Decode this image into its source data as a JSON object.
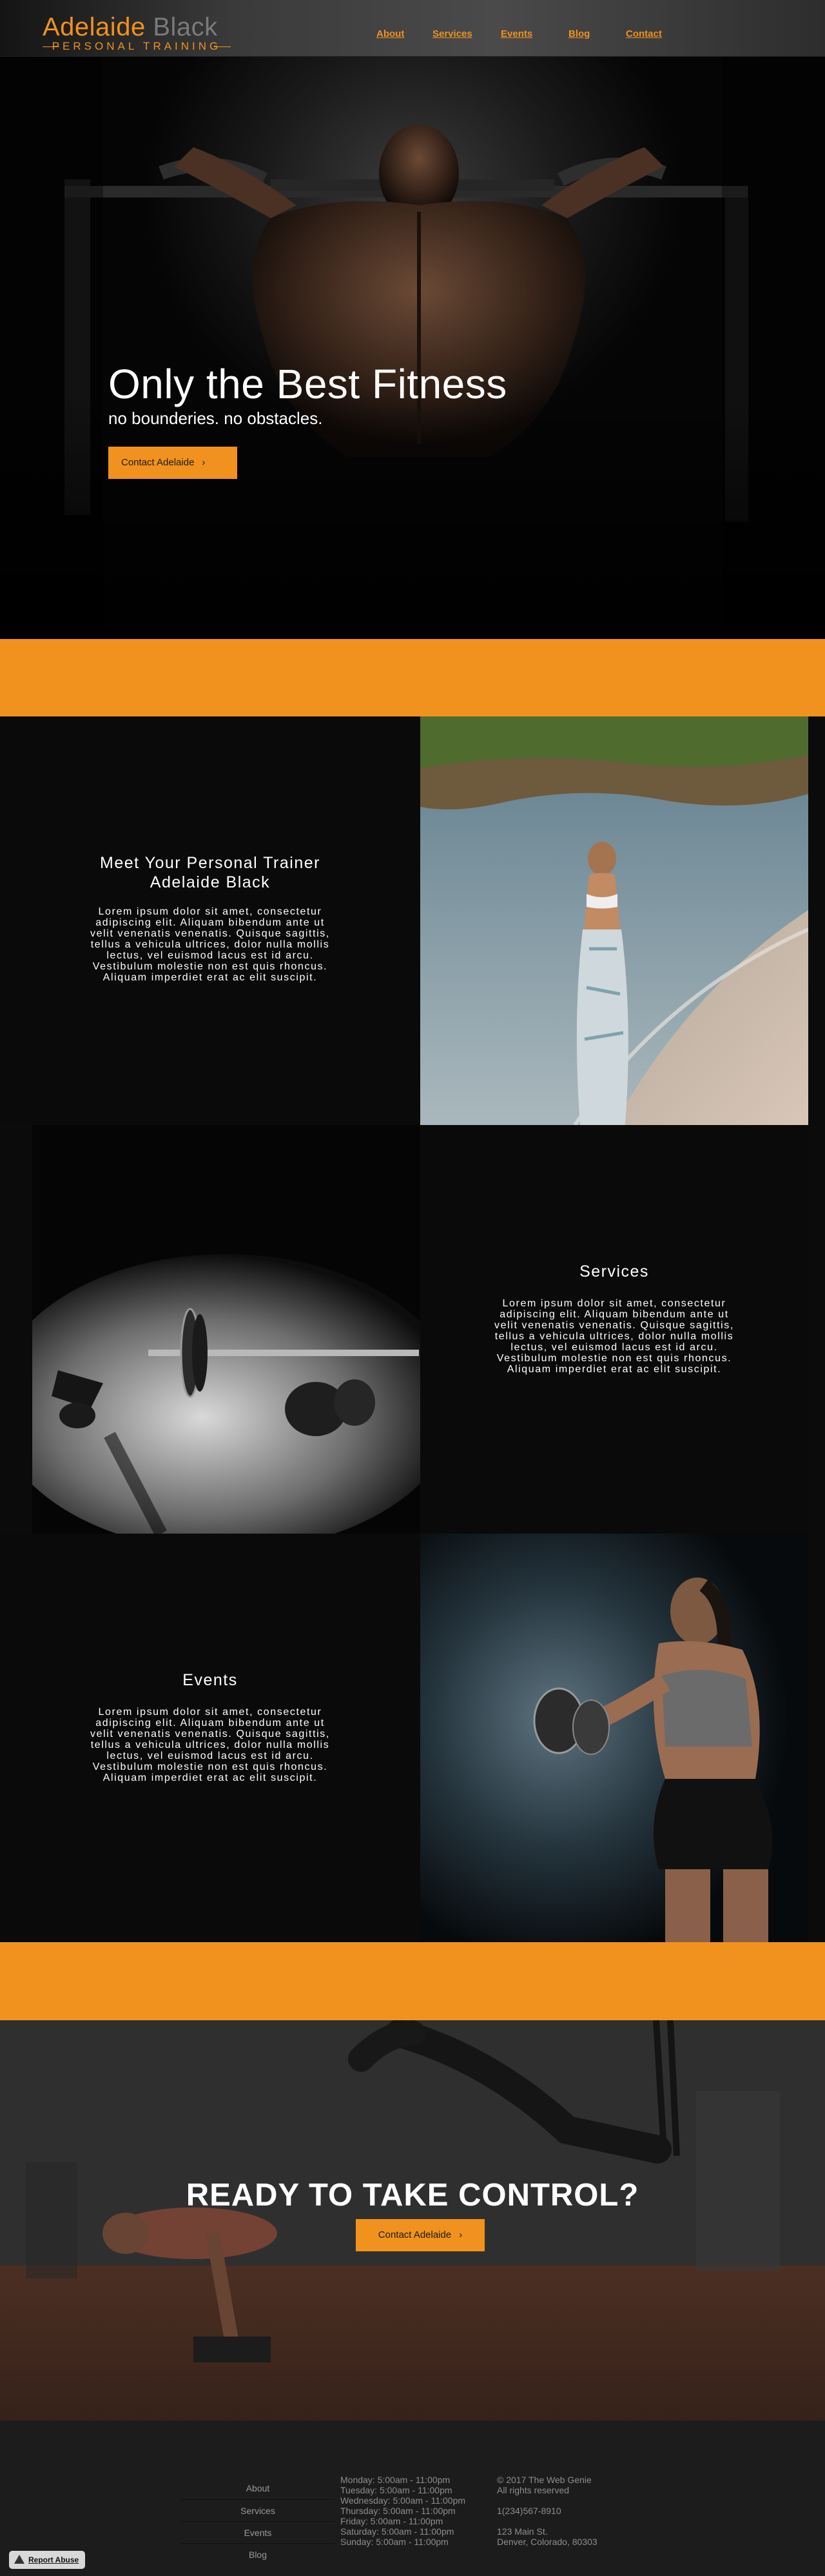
{
  "header": {
    "logo": {
      "word1": "Adelaide",
      "word2": "Black",
      "tagline": "PERSONAL TRAINING"
    },
    "nav": [
      {
        "label": "About"
      },
      {
        "label": "Services"
      },
      {
        "label": "Events"
      },
      {
        "label": "Blog"
      },
      {
        "label": "Contact"
      }
    ]
  },
  "hero": {
    "title": "Only the Best Fitness",
    "subtitle": "no bounderies. no obstacles.",
    "button": "Contact Adelaide"
  },
  "sections": [
    {
      "title_line1": "Meet Your Personal Trainer",
      "title_line2": "Adelaide Black",
      "body": [
        "Lorem ipsum dolor sit amet, consectetur",
        "adipiscing elit. Aliquam bibendum ante ut",
        "velit venenatis venenatis. Quisque sagittis,",
        "tellus a vehicula ultrices, dolor nulla mollis",
        "lectus, vel euismod lacus est id arcu.",
        "Vestibulum molestie non est quis rhoncus.",
        "Aliquam imperdiet erat ac elit suscipit."
      ]
    },
    {
      "title_line1": "Services",
      "body": [
        "Lorem ipsum dolor sit amet, consectetur",
        "adipiscing elit. Aliquam bibendum ante ut",
        "velit venenatis venenatis. Quisque sagittis,",
        "tellus a vehicula ultrices, dolor nulla mollis",
        "lectus, vel euismod lacus est id arcu.",
        "Vestibulum molestie non est quis rhoncus.",
        "Aliquam imperdiet erat ac elit suscipit."
      ]
    },
    {
      "title_line1": "Events",
      "body": [
        "Lorem ipsum dolor sit amet, consectetur",
        "adipiscing elit. Aliquam bibendum ante ut",
        "velit venenatis venenatis. Quisque sagittis,",
        "tellus a vehicula ultrices, dolor nulla mollis",
        "lectus, vel euismod lacus est id arcu.",
        "Vestibulum molestie non est quis rhoncus.",
        "Aliquam imperdiet erat ac elit suscipit."
      ]
    }
  ],
  "cta": {
    "title": "READY TO TAKE CONTROL?",
    "button": "Contact Adelaide"
  },
  "footer": {
    "nav": [
      "About",
      "Services",
      "Events",
      "Blog"
    ],
    "hours": [
      "Monday: 5:00am - 11:00pm",
      "Tuesday: 5:00am - 11:00pm",
      "Wednesday: 5:00am - 11:00pm",
      "Thursday: 5:00am - 11:00pm",
      "Friday: 5:00am - 11:00pm",
      "Saturday: 5:00am - 11:00pm",
      "Sunday: 5:00am - 11:00pm"
    ],
    "contact": [
      "© 2017 The Web Genie",
      "All rights reserved",
      "",
      "1(234)567-8910",
      "",
      "123 Main St.",
      "Denver, Colorado, 80303"
    ],
    "report_abuse": "Report Abuse"
  },
  "colors": {
    "accent": "#f2921e",
    "background": "#0b0b0b",
    "footer": "#1c1c1c"
  },
  "icons": {
    "button_chevron": "chevron-right-icon",
    "report": "warning-icon"
  }
}
